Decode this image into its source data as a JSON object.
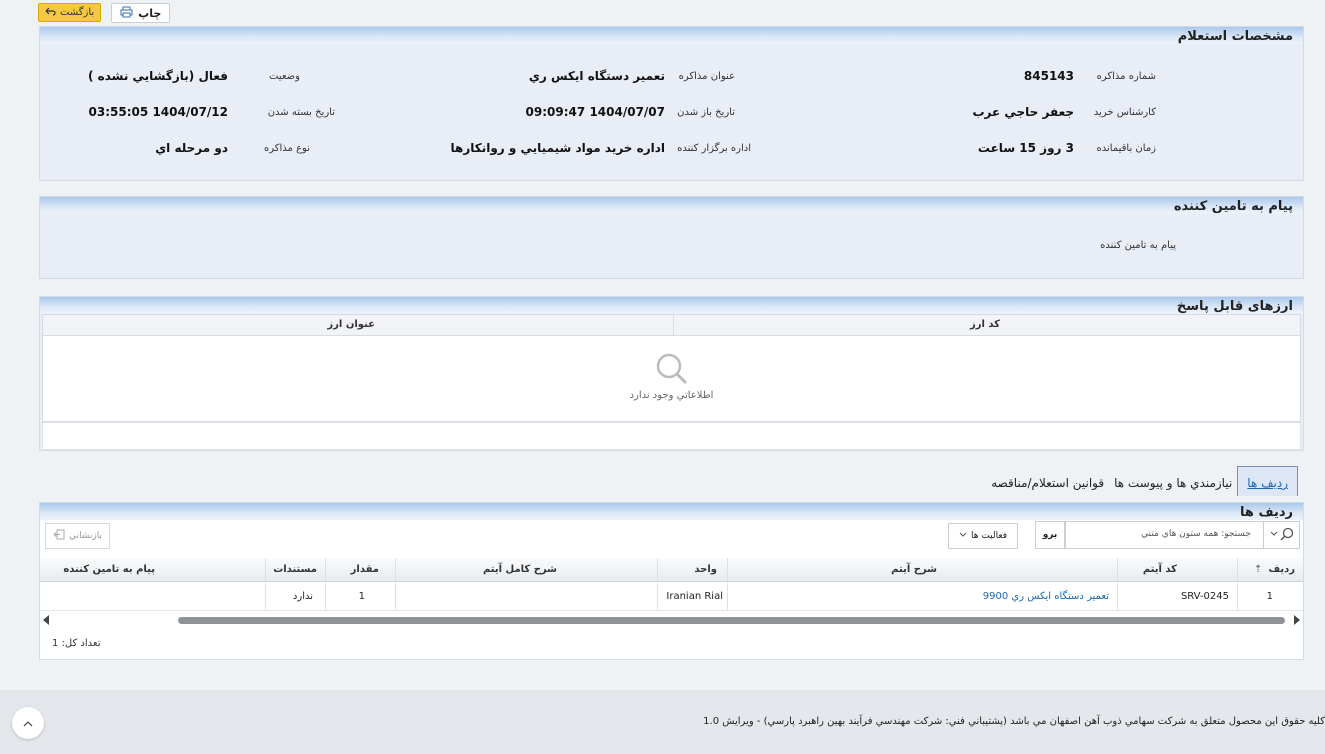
{
  "toolbar": {
    "back_label": "بازگشت",
    "print_label": "چاپ"
  },
  "details": {
    "title": "مشخصات استعلام",
    "fields": {
      "number_label": "شماره مذاکره",
      "number_value": "845143",
      "subject_label": "عنوان مذاکره",
      "subject_value": "تعمير دستگاه ايکس ري",
      "status_label": "وضعيت",
      "status_value": "فعال (بازگشايي نشده )",
      "expert_label": "کارشناس خريد",
      "expert_value": "جعفر حاجي عرب",
      "open_date_label": "تاريخ باز شدن",
      "open_date_value": "1404/07/07 09:09:47",
      "close_date_label": "تاريخ بسته شدن",
      "close_date_value": "1404/07/12 03:55:05",
      "remaining_label": "زمان باقيمانده",
      "remaining_value": "3 روز 15 ساعت",
      "office_label": "اداره برگزار کننده",
      "office_value": "اداره خريد مواد شيميايي و روانكارها",
      "type_label": "نوع مذاکره",
      "type_value": "دو مرحله اي"
    }
  },
  "message": {
    "title": "پيام به تامين کننده",
    "label": "پيام به تامين کننده"
  },
  "currencies": {
    "title": "ارزهای قابل پاسخ",
    "col_code": "کد ارز",
    "col_title": "عنوان ارز",
    "empty_text": "اطلاعاتي وجود ندارد"
  },
  "tabs": [
    {
      "label": "رديف ها"
    },
    {
      "label": "نيازمندي ها و پيوست ها"
    },
    {
      "label": "قوانين استعلام/مناقصه"
    }
  ],
  "rows": {
    "title": "رديف ها",
    "search_placeholder": "جستجو: همه ستون هاي متني",
    "go_label": "برو",
    "actions_label": "فعاليت ها",
    "return_label": "بازنشاني",
    "columns": {
      "row": "رديف",
      "code": "کد آيتم",
      "desc": "شرح آيتم",
      "unit": "واحد",
      "full_desc": "شرح کامل آيتم",
      "qty": "مقدار",
      "docs": "مستندات",
      "msg": "پيام به تامين کننده"
    },
    "items": [
      {
        "row": "1",
        "code": "SRV-0245",
        "desc": "تعمير دستگاه ايکس ري 9900",
        "unit": "Iranian Rial",
        "full_desc": "",
        "qty": "1",
        "docs": "ندارد",
        "msg": ""
      }
    ],
    "total_label": "تعداد کل: 1"
  },
  "footer": {
    "text": "کليه حقوق اين محصول متعلق به شرکت سهامي ذوب آهن اصفهان مي باشد (پشتيباني فني: شرکت مهندسي فرآيند بهين راهبرد پارسي) - ويرايش 1.0"
  }
}
